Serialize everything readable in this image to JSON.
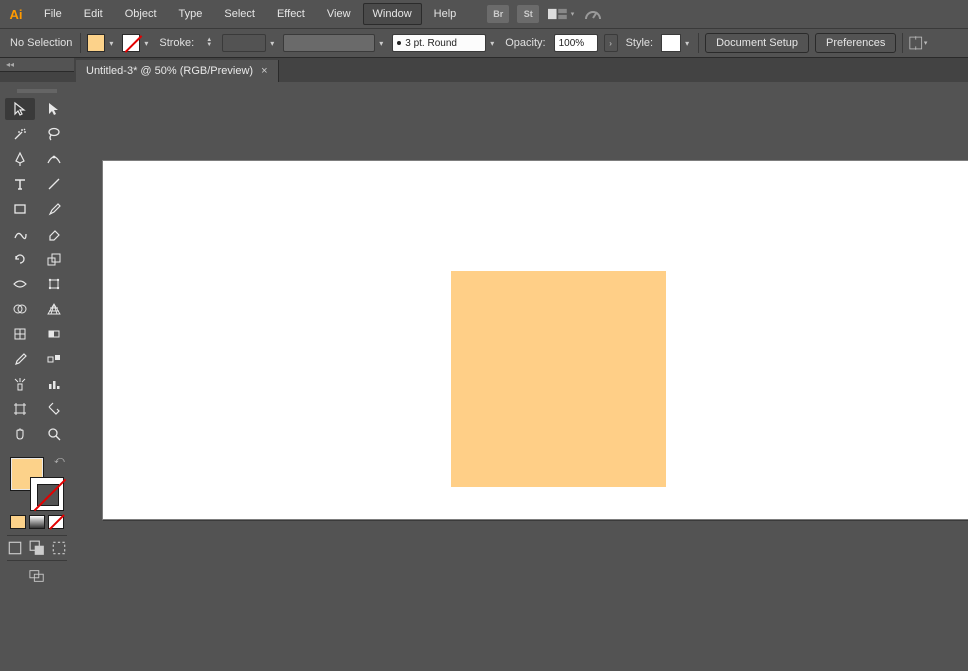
{
  "app": {
    "logo": "Ai"
  },
  "menu": {
    "items": [
      "File",
      "Edit",
      "Object",
      "Type",
      "Select",
      "Effect",
      "View",
      "Window",
      "Help"
    ],
    "active_index": 7,
    "shortcut_br": "Br",
    "shortcut_st": "St"
  },
  "control": {
    "selection_label": "No Selection",
    "fill_color": "#fcd28a",
    "stroke_label": "Stroke:",
    "brush_label": "3 pt. Round",
    "opacity_label": "Opacity:",
    "opacity_value": "100%",
    "style_label": "Style:",
    "doc_setup": "Document Setup",
    "preferences": "Preferences"
  },
  "tab": {
    "title": "Untitled-3* @ 50% (RGB/Preview)"
  },
  "tools": {
    "names": [
      "selection-tool",
      "direct-selection-tool",
      "magic-wand-tool",
      "lasso-tool",
      "pen-tool",
      "curvature-tool",
      "type-tool",
      "line-segment-tool",
      "rectangle-tool",
      "paintbrush-tool",
      "shaper-tool",
      "eraser-tool",
      "rotate-tool",
      "scale-tool",
      "width-tool",
      "free-transform-tool",
      "shape-builder-tool",
      "perspective-grid-tool",
      "mesh-tool",
      "gradient-tool",
      "eyedropper-tool",
      "blend-tool",
      "symbol-sprayer-tool",
      "column-graph-tool",
      "artboard-tool",
      "slice-tool",
      "hand-tool",
      "zoom-tool"
    ]
  },
  "colors": {
    "fill": "#fcd28a",
    "shape": "#ffcf87",
    "mini": [
      "#fcd28a",
      "#808080",
      "#ffffff"
    ]
  }
}
